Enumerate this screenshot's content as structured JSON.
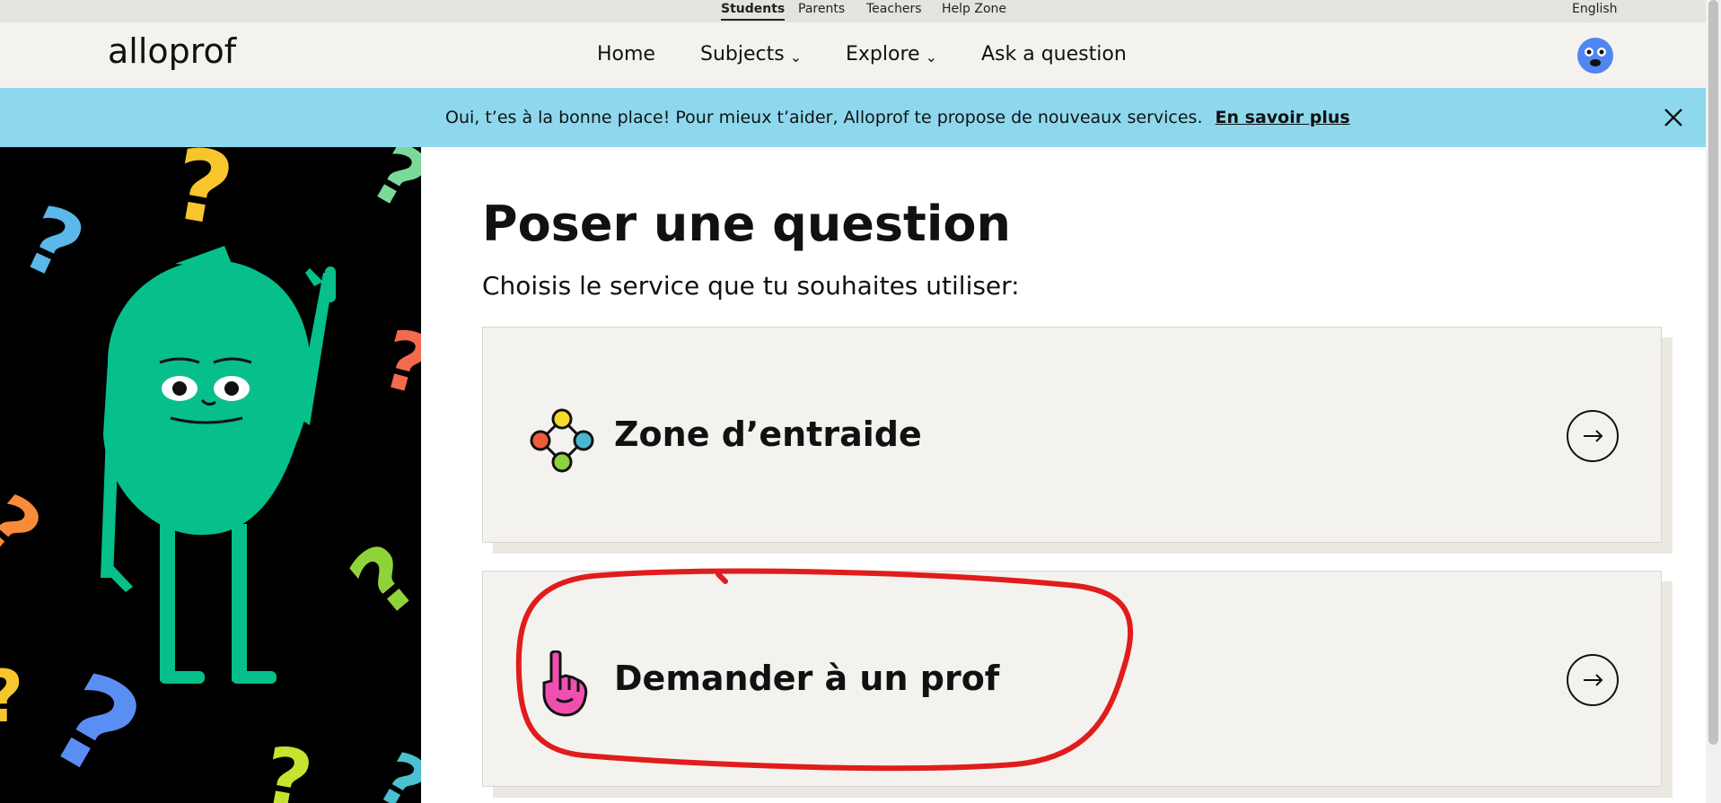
{
  "topbar": {
    "audiences": [
      "Students",
      "Parents",
      "Teachers",
      "Help Zone"
    ],
    "language": "English"
  },
  "header": {
    "logo_text": "alloprof",
    "nav": {
      "home": "Home",
      "subjects": "Subjects",
      "explore": "Explore",
      "ask": "Ask a question"
    }
  },
  "banner": {
    "text": "Oui, t’es à la bonne place! Pour mieux t’aider, Alloprof te propose de nouveaux services.",
    "link": "En savoir plus"
  },
  "main": {
    "title": "Poser une question",
    "subtitle": "Choisis le service que tu souhaites utiliser:",
    "cards": [
      {
        "label": "Zone d’entraide",
        "icon": "helping-zone-icon"
      },
      {
        "label": "Demander à un prof",
        "icon": "raised-hand-icon"
      }
    ]
  },
  "colors": {
    "banner": "#8ed8ee",
    "header": "#f4f2ee",
    "annotation": "#e11c1c",
    "mascot": "#07bf8a",
    "avatar": "#4f86f0"
  }
}
